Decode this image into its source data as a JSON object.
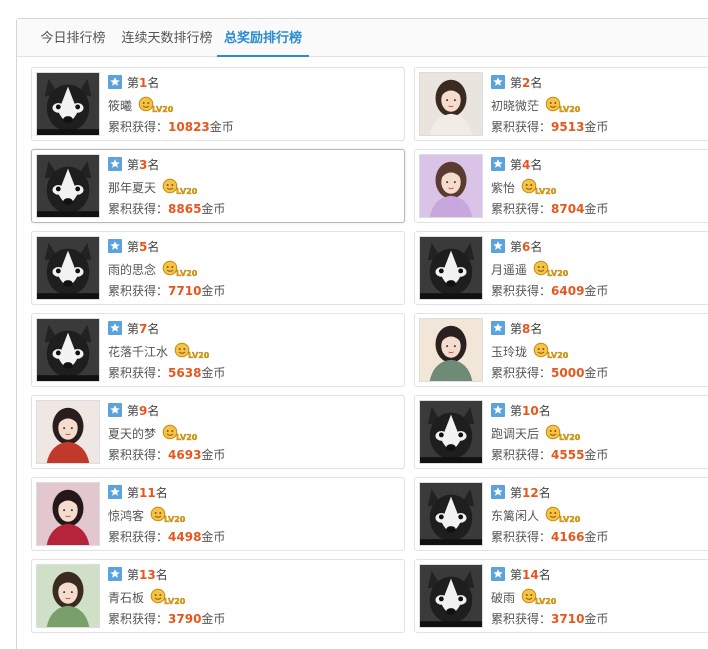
{
  "tabs": [
    {
      "label": "今日排行榜",
      "active": false
    },
    {
      "label": "连续天数排行榜",
      "active": false
    },
    {
      "label": "总奖励排行榜",
      "active": true
    }
  ],
  "rank_prefix": "第",
  "rank_suffix": "名",
  "gain_label": "累积获得：",
  "coin_unit": "金币",
  "level_badge": "LV20",
  "colors": {
    "accent": "#2a8bd4",
    "highlight": "#e8561d",
    "rank_icon": "#5ba3dc",
    "badge": "#e6a100"
  },
  "entries": [
    {
      "rank": "1",
      "name": "筱曦",
      "gold": "10823",
      "avatar": "dog"
    },
    {
      "rank": "2",
      "name": "初晓微茫",
      "gold": "9513",
      "avatar": "girl-white"
    },
    {
      "rank": "3",
      "name": "那年夏天",
      "gold": "8865",
      "avatar": "dog"
    },
    {
      "rank": "4",
      "name": "紫怡",
      "gold": "8704",
      "avatar": "girl-purple"
    },
    {
      "rank": "5",
      "name": "雨的思念",
      "gold": "7710",
      "avatar": "dog"
    },
    {
      "rank": "6",
      "name": "月遥遥",
      "gold": "6409",
      "avatar": "dog"
    },
    {
      "rank": "7",
      "name": "花落千江水",
      "gold": "5638",
      "avatar": "dog"
    },
    {
      "rank": "8",
      "name": "玉玲珑",
      "gold": "5000",
      "avatar": "girl-cream"
    },
    {
      "rank": "9",
      "name": "夏天的梦",
      "gold": "4693",
      "avatar": "girl-red"
    },
    {
      "rank": "10",
      "name": "跑调天后",
      "gold": "4555",
      "avatar": "dog"
    },
    {
      "rank": "11",
      "name": "惊鸿客",
      "gold": "4498",
      "avatar": "girl-pink"
    },
    {
      "rank": "12",
      "name": "东篱闲人",
      "gold": "4166",
      "avatar": "dog"
    },
    {
      "rank": "13",
      "name": "青石板",
      "gold": "3790",
      "avatar": "girl-green"
    },
    {
      "rank": "14",
      "name": "破雨",
      "gold": "3710",
      "avatar": "dog"
    }
  ]
}
